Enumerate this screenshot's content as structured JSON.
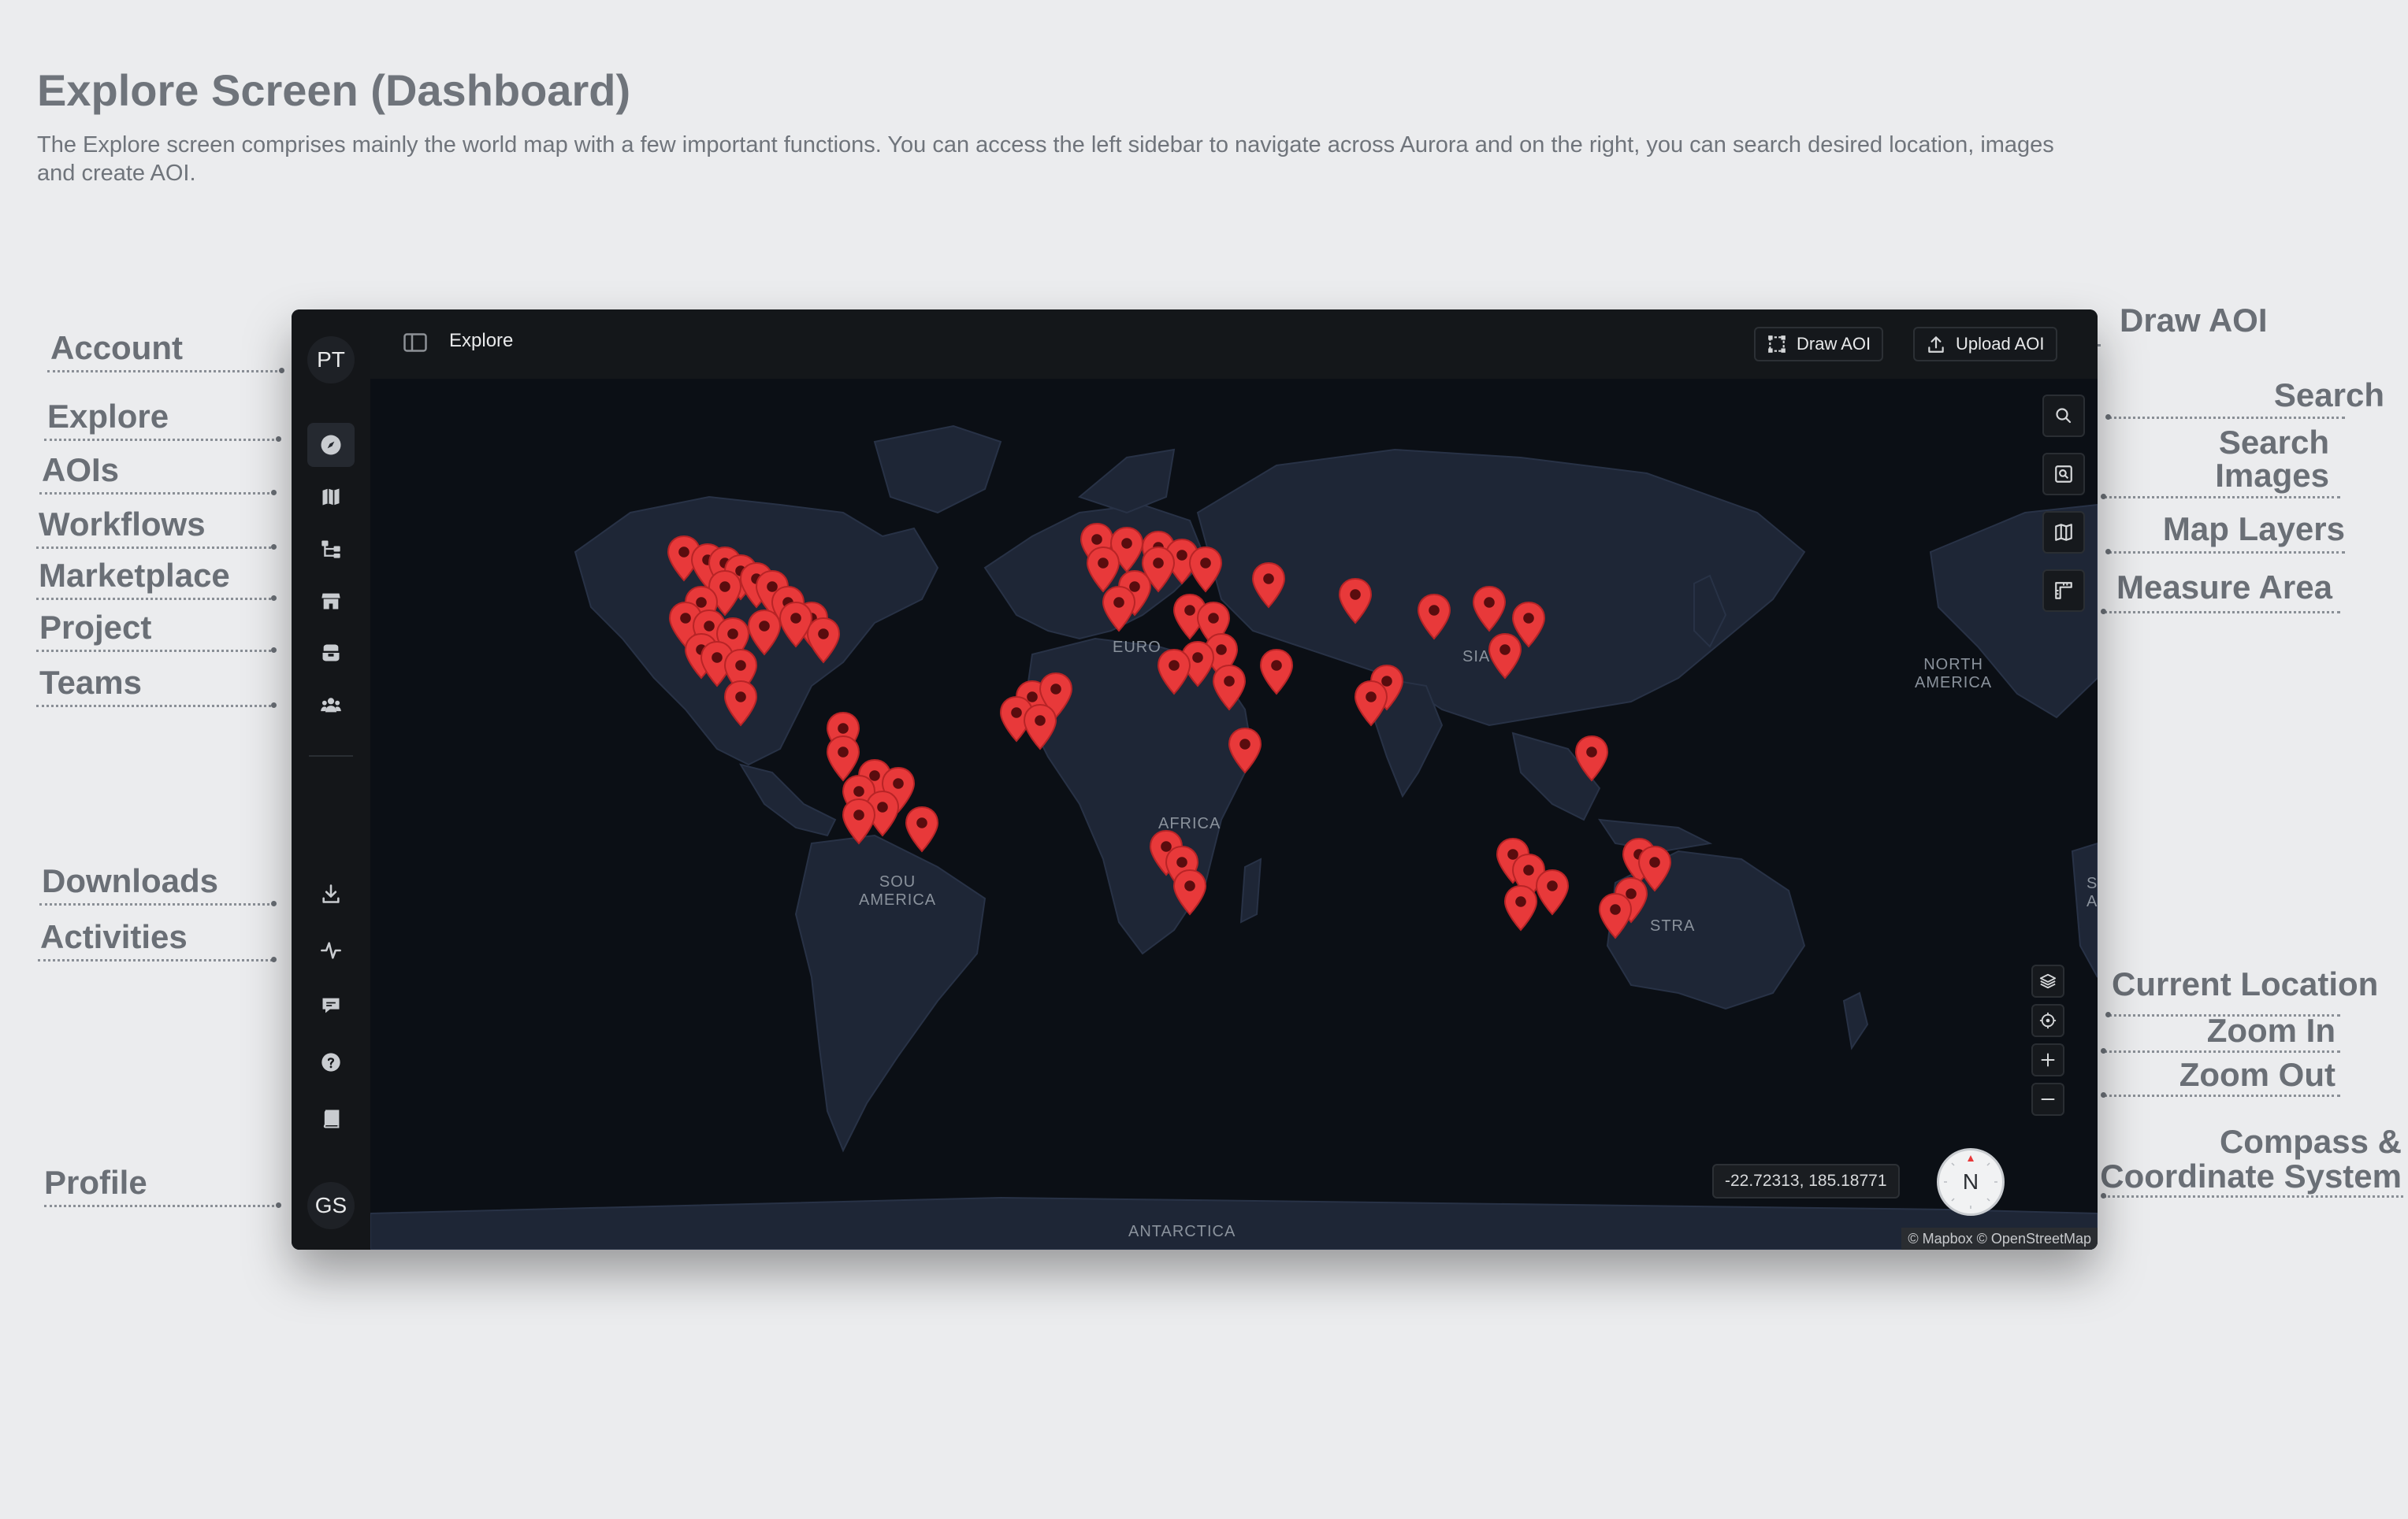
{
  "page": {
    "title": "Explore Screen (Dashboard)",
    "description": "The Explore screen comprises mainly the world map with a few important functions. You can access the left sidebar to navigate across Aurora and on the right, you can search desired location, images and create AOI."
  },
  "callouts": {
    "account": "Account",
    "explore": "Explore",
    "aois": "AOIs",
    "workflows": "Workflows",
    "marketplace": "Marketplace",
    "project": "Project",
    "teams": "Teams",
    "downloads": "Downloads",
    "activities": "Activities",
    "profile": "Profile",
    "draw_aoi": "Draw AOI",
    "search": "Search",
    "search_images_1": "Search",
    "search_images_2": "Images",
    "map_layers": "Map Layers",
    "measure_area": "Measure Area",
    "current_location": "Current Location",
    "zoom_in": "Zoom In",
    "zoom_out": "Zoom Out",
    "compass_1": "Compass &",
    "compass_2": "Coordinate System"
  },
  "app": {
    "account_initials": "PT",
    "profile_initials": "GS",
    "topbar": {
      "title": "Explore",
      "draw_aoi_label": "Draw AOI",
      "upload_aoi_label": "Upload AOI"
    },
    "map": {
      "coordinates": "-22.72313, 185.18771",
      "compass_label": "N",
      "attribution": "© Mapbox © OpenStreetMap",
      "labels": {
        "europe": "EURO",
        "asia": "SIA",
        "africa": "AFRICA",
        "south_america_1": "SOU",
        "south_america_2": "AMERICA",
        "australia": "STRA",
        "north_america_1": "NORTH",
        "north_america_2": "AMERICA",
        "sa_right_1": "S",
        "sa_right_2": "AM",
        "antarctica": "ANTARCTICA"
      },
      "pin_color": "#e8393a"
    }
  }
}
